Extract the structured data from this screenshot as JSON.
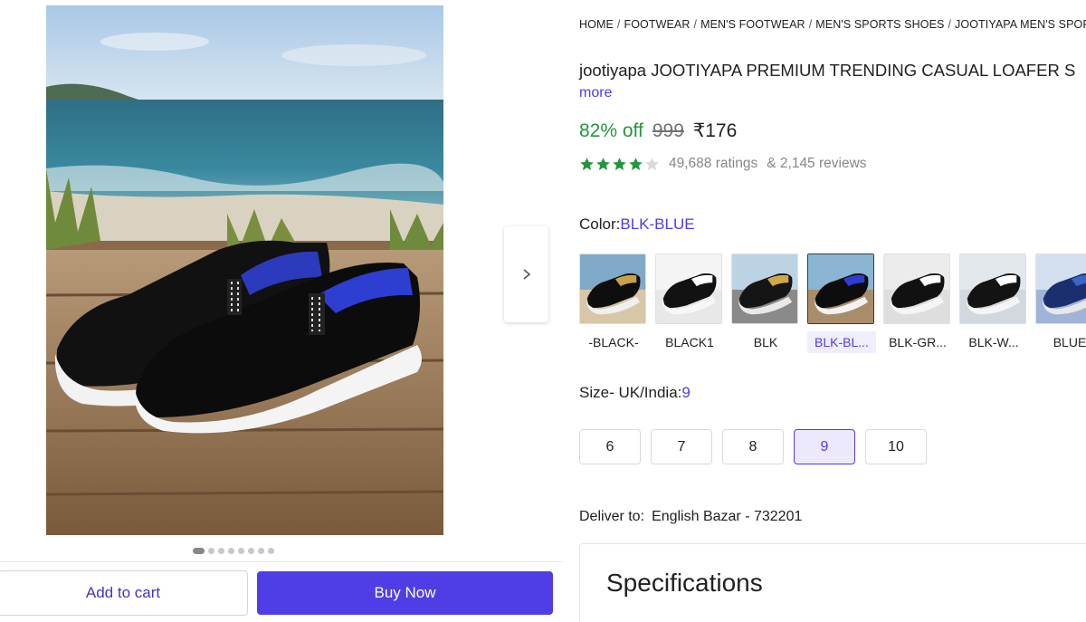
{
  "gallery": {
    "main_image_alt": "",
    "dots_count": 8,
    "active_dot": 0
  },
  "actions": {
    "add_to_cart": "Add to cart",
    "buy_now": "Buy Now"
  },
  "breadcrumb": [
    "HOME",
    "FOOTWEAR",
    "MEN'S FOOTWEAR",
    "MEN'S SPORTS SHOES",
    "JOOTIYAPA MEN'S SPORTS SH"
  ],
  "product": {
    "title": "jootiyapa JOOTIYAPA PREMIUM TRENDING CASUAL LOAFER S",
    "more": "more",
    "discount": "82% off",
    "mrp": "999",
    "price": "₹176",
    "rating": 4,
    "ratings_text": "49,688 ratings",
    "reviews_text": "& 2,145 reviews"
  },
  "color": {
    "label": "Color:",
    "selected": "BLK-BLUE",
    "options": [
      {
        "label": "-BLACK-",
        "theme": "beach-gold"
      },
      {
        "label": "BLACK1",
        "theme": "white-lace"
      },
      {
        "label": "BLK",
        "theme": "city-gold"
      },
      {
        "label": "BLK-BL...",
        "theme": "beach-slipon",
        "selected": true
      },
      {
        "label": "BLK-GR...",
        "theme": "white-slipon"
      },
      {
        "label": "BLK-W...",
        "theme": "white-slipon2"
      },
      {
        "label": "BLUE",
        "theme": "blue-runner"
      }
    ]
  },
  "size": {
    "label": "Size- UK/India:",
    "selected": "9",
    "options": [
      "6",
      "7",
      "8",
      "9",
      "10"
    ]
  },
  "delivery": {
    "label": "Deliver to:",
    "location": "English Bazar - 732201"
  },
  "specs": {
    "title": "Specifications"
  },
  "colors": {
    "accent": "#4f3de6",
    "green": "#22963c",
    "star": "#22963c"
  }
}
